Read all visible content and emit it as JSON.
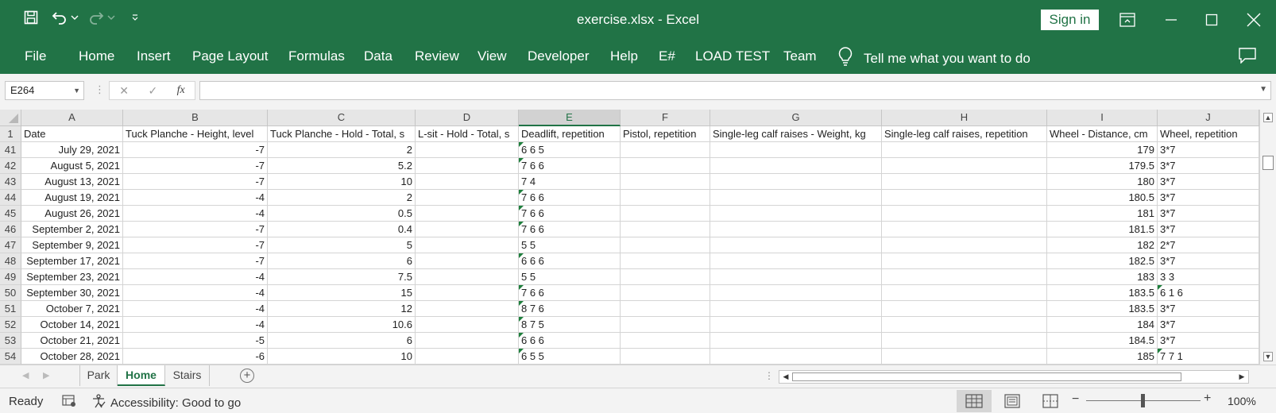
{
  "titlebar": {
    "title": "exercise.xlsx  -  Excel",
    "sign_in": "Sign in"
  },
  "ribbon": {
    "tabs": [
      "File",
      "Home",
      "Insert",
      "Page Layout",
      "Formulas",
      "Data",
      "Review",
      "View",
      "Developer",
      "Help",
      "E#",
      "LOAD TEST",
      "Team"
    ],
    "tell_me": "Tell me what you want to do"
  },
  "formula_bar": {
    "name_box": "E264",
    "cancel_icon": "✕",
    "enter_icon": "✓",
    "fx_label": "fx",
    "formula": ""
  },
  "sheet": {
    "columns": [
      {
        "letter": "A",
        "selected": false
      },
      {
        "letter": "B",
        "selected": false
      },
      {
        "letter": "C",
        "selected": false
      },
      {
        "letter": "D",
        "selected": false
      },
      {
        "letter": "E",
        "selected": true
      },
      {
        "letter": "F",
        "selected": false
      },
      {
        "letter": "G",
        "selected": false
      },
      {
        "letter": "H",
        "selected": false
      },
      {
        "letter": "I",
        "selected": false
      },
      {
        "letter": "J",
        "selected": false
      }
    ],
    "header_row": {
      "row": "1",
      "cells": [
        "Date",
        "Tuck Planche - Height, level",
        "Tuck Planche - Hold - Total, s",
        "L-sit - Hold - Total, s",
        "Deadlift, repetition",
        "Pistol, repetition",
        "Single-leg calf raises - Weight, kg",
        "Single-leg calf raises, repetition",
        "Wheel - Distance, cm",
        "Wheel, repetition"
      ]
    },
    "rows": [
      {
        "row": "41",
        "date": "July 29, 2021",
        "b": "-7",
        "c": "2",
        "d": "",
        "e": "6 6 5",
        "f": "",
        "g": "",
        "h": "",
        "i": "179",
        "j": "3*7",
        "e_flag": true,
        "j_flag": false
      },
      {
        "row": "42",
        "date": "August 5, 2021",
        "b": "-7",
        "c": "5.2",
        "d": "",
        "e": "7 6 6",
        "f": "",
        "g": "",
        "h": "",
        "i": "179.5",
        "j": "3*7",
        "e_flag": true,
        "j_flag": false
      },
      {
        "row": "43",
        "date": "August 13, 2021",
        "b": "-7",
        "c": "10",
        "d": "",
        "e": "7 4",
        "f": "",
        "g": "",
        "h": "",
        "i": "180",
        "j": "3*7",
        "e_flag": false,
        "j_flag": false
      },
      {
        "row": "44",
        "date": "August 19, 2021",
        "b": "-4",
        "c": "2",
        "d": "",
        "e": "7 6 6",
        "f": "",
        "g": "",
        "h": "",
        "i": "180.5",
        "j": "3*7",
        "e_flag": true,
        "j_flag": false
      },
      {
        "row": "45",
        "date": "August 26, 2021",
        "b": "-4",
        "c": "0.5",
        "d": "",
        "e": "7 6 6",
        "f": "",
        "g": "",
        "h": "",
        "i": "181",
        "j": "3*7",
        "e_flag": true,
        "j_flag": false
      },
      {
        "row": "46",
        "date": "September 2, 2021",
        "b": "-7",
        "c": "0.4",
        "d": "",
        "e": "7 6 6",
        "f": "",
        "g": "",
        "h": "",
        "i": "181.5",
        "j": "3*7",
        "e_flag": true,
        "j_flag": false
      },
      {
        "row": "47",
        "date": "September 9, 2021",
        "b": "-7",
        "c": "5",
        "d": "",
        "e": "5 5",
        "f": "",
        "g": "",
        "h": "",
        "i": "182",
        "j": "2*7",
        "e_flag": false,
        "j_flag": false
      },
      {
        "row": "48",
        "date": "September 17, 2021",
        "b": "-7",
        "c": "6",
        "d": "",
        "e": "6 6 6",
        "f": "",
        "g": "",
        "h": "",
        "i": "182.5",
        "j": "3*7",
        "e_flag": true,
        "j_flag": false
      },
      {
        "row": "49",
        "date": "September 23, 2021",
        "b": "-4",
        "c": "7.5",
        "d": "",
        "e": "5 5",
        "f": "",
        "g": "",
        "h": "",
        "i": "183",
        "j": "3 3",
        "e_flag": false,
        "j_flag": false
      },
      {
        "row": "50",
        "date": "September 30, 2021",
        "b": "-4",
        "c": "15",
        "d": "",
        "e": "7 6 6",
        "f": "",
        "g": "",
        "h": "",
        "i": "183.5",
        "j": "6 1 6",
        "e_flag": true,
        "j_flag": true
      },
      {
        "row": "51",
        "date": "October 7, 2021",
        "b": "-4",
        "c": "12",
        "d": "",
        "e": "8 7 6",
        "f": "",
        "g": "",
        "h": "",
        "i": "183.5",
        "j": "3*7",
        "e_flag": true,
        "j_flag": false
      },
      {
        "row": "52",
        "date": "October 14, 2021",
        "b": "-4",
        "c": "10.6",
        "d": "",
        "e": "8 7 5",
        "f": "",
        "g": "",
        "h": "",
        "i": "184",
        "j": "3*7",
        "e_flag": true,
        "j_flag": false
      },
      {
        "row": "53",
        "date": "October 21, 2021",
        "b": "-5",
        "c": "6",
        "d": "",
        "e": "6 6 6",
        "f": "",
        "g": "",
        "h": "",
        "i": "184.5",
        "j": "3*7",
        "e_flag": true,
        "j_flag": false
      },
      {
        "row": "54",
        "date": "October 28, 2021",
        "b": "-6",
        "c": "10",
        "d": "",
        "e": "6 5 5",
        "f": "",
        "g": "",
        "h": "",
        "i": "185",
        "j": "7 7 1",
        "e_flag": true,
        "j_flag": true
      }
    ]
  },
  "sheet_tabs": [
    {
      "name": "Park",
      "active": false
    },
    {
      "name": "Home",
      "active": true
    },
    {
      "name": "Stairs",
      "active": false
    }
  ],
  "status": {
    "ready": "Ready",
    "accessibility": "Accessibility: Good to go",
    "zoom": "100%",
    "zoom_minus": "−",
    "zoom_plus": "+"
  },
  "colors": {
    "brand": "#217346",
    "error_flag": "#1e7f3c"
  }
}
